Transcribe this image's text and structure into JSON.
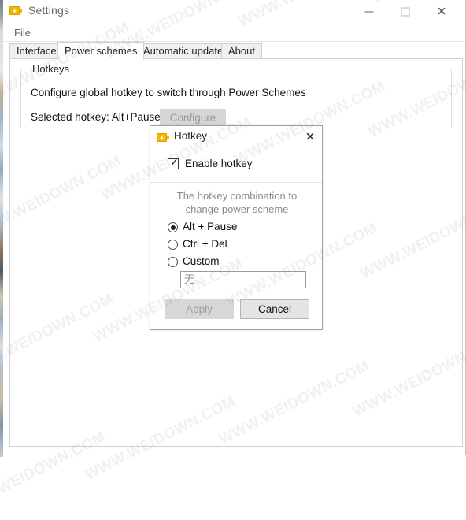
{
  "window": {
    "title": "Settings",
    "icon": "battery-charging-icon",
    "controls": {
      "minimize": "minimize-icon",
      "maximize": "maximize-icon",
      "close": "close-icon"
    }
  },
  "menu": {
    "items": [
      "File"
    ]
  },
  "tabs": [
    {
      "label": "Interface",
      "selected": false
    },
    {
      "label": "Power schemes",
      "selected": true
    },
    {
      "label": "Automatic updates",
      "selected": false
    },
    {
      "label": "About",
      "selected": false
    }
  ],
  "hotkeys_group": {
    "title": "Hotkeys",
    "description": "Configure global hotkey to switch through Power Schemes",
    "selected_hotkey_label": "Selected hotkey: Alt+Pause",
    "configure_button": "Configure",
    "configure_button_enabled": false
  },
  "dialog": {
    "title": "Hotkey",
    "icon": "battery-charging-icon",
    "close_icon": "close-icon",
    "enable_checkbox": {
      "label": "Enable hotkey",
      "checked": true,
      "glyph": "✓"
    },
    "radio_caption": "The hotkey combination to change power scheme",
    "radios": [
      {
        "label": "Alt + Pause",
        "selected": true
      },
      {
        "label": "Ctrl + Del",
        "selected": false
      },
      {
        "label": "Custom",
        "selected": false
      }
    ],
    "custom_input": {
      "value": "无",
      "placeholder": "无"
    },
    "buttons": {
      "apply": "Apply",
      "apply_enabled": false,
      "cancel": "Cancel",
      "cancel_enabled": true
    }
  },
  "watermark": {
    "text": "WWW.WEIDOWN.COM"
  },
  "colors": {
    "accent": "#f7b500",
    "window_bg": "#ffffff",
    "disabled_text": "#9a9a9a",
    "border": "#d0d0d0"
  }
}
